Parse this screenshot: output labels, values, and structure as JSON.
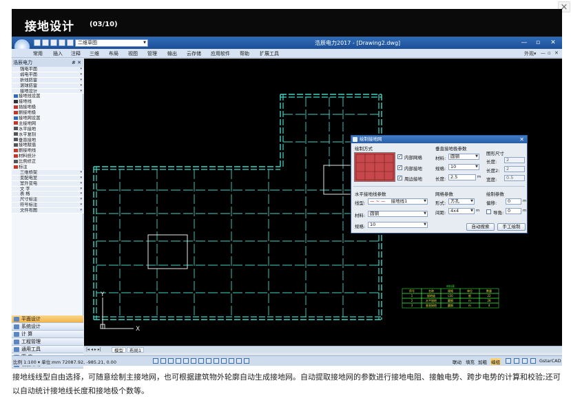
{
  "slide": {
    "title": "接地设计",
    "counter": "(03/10)",
    "close": "×"
  },
  "app": {
    "window_title": "浩辰电力2017 - [Drawing2.dwg]",
    "workspace": "二维草图",
    "window_buttons": [
      "—",
      "▫",
      "✕"
    ],
    "doc_buttons": [
      "—",
      "▫",
      "✕"
    ],
    "menu": [
      "常用",
      "插入",
      "注释",
      "三维",
      "布局",
      "视图",
      "管理",
      "输出",
      "云存储",
      "应用软件",
      "帮助",
      "扩展工具"
    ],
    "menu_right": "外观▾"
  },
  "sidebar": {
    "header": "浩辰电力",
    "pin": "# ✕",
    "rows": [
      {
        "type": "sub",
        "label": "强电平面"
      },
      {
        "type": "sub",
        "label": "弱电平面"
      },
      {
        "type": "sub",
        "label": "折线防雷"
      },
      {
        "type": "sub",
        "label": "滚球防雷"
      },
      {
        "type": "sub",
        "label": "接地设计"
      },
      {
        "type": "item",
        "label": "接地线设置",
        "color": "#2f6bb8"
      },
      {
        "type": "item",
        "label": "接地线",
        "color": "#333333"
      },
      {
        "type": "item",
        "label": "插接地极",
        "color": "#c0392b"
      },
      {
        "type": "item",
        "label": "删接地极",
        "color": "#c0392b"
      },
      {
        "type": "item",
        "label": "接地网设置",
        "color": "#2f6bb8"
      },
      {
        "type": "item",
        "label": "主接地网",
        "color": "#c0392b"
      },
      {
        "type": "item",
        "label": "水平接地",
        "color": "#555555"
      },
      {
        "type": "item",
        "label": "水平复制",
        "color": "#555555"
      },
      {
        "type": "item",
        "label": "垂直接地",
        "color": "#555555"
      },
      {
        "type": "item",
        "label": "接地赋值",
        "color": "#555555"
      },
      {
        "type": "item",
        "label": "删接地线",
        "color": "#c0392b"
      },
      {
        "type": "item",
        "label": "材料统计",
        "color": "#c0392b"
      },
      {
        "type": "item",
        "label": "比例修正",
        "color": "#555555"
      },
      {
        "type": "item",
        "label": "标注",
        "color": "#c0392b"
      },
      {
        "type": "sub",
        "label": "三维桥架"
      },
      {
        "type": "sub",
        "label": "变配电室"
      },
      {
        "type": "sub",
        "label": "室外变电"
      },
      {
        "type": "sub",
        "label": "文    字"
      },
      {
        "type": "sub",
        "label": "表    格"
      },
      {
        "type": "sub",
        "label": "尺寸标注"
      },
      {
        "type": "sub",
        "label": "符号标注"
      },
      {
        "type": "sub",
        "label": "文件布图"
      }
    ],
    "categories": [
      {
        "label": "平面设计",
        "active": true
      },
      {
        "label": "系统设计",
        "active": false
      },
      {
        "label": "计    算",
        "active": false
      },
      {
        "label": "工程管理",
        "active": false
      },
      {
        "label": "通用工具",
        "active": false
      },
      {
        "label": "图    库",
        "active": false
      },
      {
        "label": "设置帮助",
        "active": false
      }
    ]
  },
  "tabs": {
    "nav": "|◂ ◂ ▸ ▸|",
    "items": [
      "模型",
      "布局1"
    ]
  },
  "status": {
    "coords": "比例 1:100 ▾ 单位:mm  72087.92, -985.21, 0.00",
    "toggles": [
      "联动",
      "填充",
      "加粗",
      "编组"
    ],
    "brand": "GstarCAD"
  },
  "canvas": {
    "axis_y": "Y",
    "axis_x": "X",
    "table_title": "材料表",
    "table_rows": [
      [
        "序号",
        "名称",
        "规格",
        "单位",
        "数量"
      ],
      [
        "1",
        "接地极",
        "L50",
        "根",
        "22"
      ],
      [
        "2",
        "水平接地",
        "圆钢",
        "m",
        "28"
      ],
      [
        "3",
        "垂直接地",
        "圆钢",
        "m",
        "4"
      ]
    ]
  },
  "dialog": {
    "title": "绘制接地网",
    "close": "✕",
    "draw_mode": {
      "label": "绘制方式",
      "options": [
        {
          "label": "内部网格",
          "checked": true
        },
        {
          "label": "内部接地",
          "checked": true
        },
        {
          "label": "周边接地",
          "checked": true
        }
      ]
    },
    "vertical": {
      "label": "垂直接地极参数",
      "material_label": "材料:",
      "material": "圆钢",
      "spec_label": "规格:",
      "spec": "10",
      "length_label": "长度:",
      "length": "2.5",
      "unit": "m"
    },
    "shape": {
      "label": "图形尺寸",
      "len1_label": "长度:",
      "len1": "2",
      "len2_label": "长度2:",
      "len2": "2",
      "width_label": "宽度:",
      "width": "0.5"
    },
    "horizontal": {
      "label": "水平接地线参数",
      "linetype_label": "线型:",
      "linetype": "接地线1",
      "material_label": "材料:",
      "material": "圆钢",
      "spec_label": "规格:",
      "spec": "10"
    },
    "grid": {
      "label": "网格参数",
      "form_label": "形式:",
      "form": "方孔",
      "spacing_label": "间距:",
      "spacing": "4x4",
      "unit": "m"
    },
    "draw": {
      "label": "绘制参数",
      "offset_label": "偏移:",
      "offset": "0",
      "corner_label": "导角:",
      "corner": "0",
      "unit": "m"
    },
    "buttons": {
      "auto": "自动搜索",
      "manual": "手工绘制"
    }
  },
  "caption": "接地线线型自由选择，可随意绘制主接地网，也可根据建筑物外轮廓自动生成接地网。自动提取接地网的参数进行接地电阻、接触电势、跨步电势的计算和校验;还可以自动统计接地线长度和接地极个数等。"
}
